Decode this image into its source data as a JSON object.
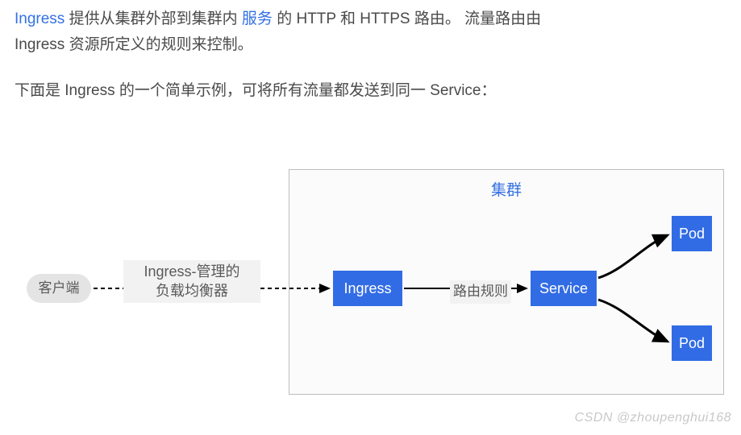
{
  "paragraph1": {
    "ingress_link": "Ingress",
    "t1": " 提供从集群外部到集群内",
    "service_link": "服务",
    "t2": "的 HTTP 和 HTTPS 路由。 流量路由由 Ingress 资源所定义的规则来控制。"
  },
  "paragraph2": "下面是 Ingress 的一个简单示例，可将所有流量都发送到同一 Service：",
  "diagram": {
    "cluster_title": "集群",
    "client": "客户端",
    "load_balancer_line1": "Ingress-管理的",
    "load_balancer_line2": "负载均衡器",
    "ingress_box": "Ingress",
    "routing_rule": "路由规则",
    "service_box": "Service",
    "pod1": "Pod",
    "pod2": "Pod"
  },
  "watermark": "CSDN @zhoupenghui168"
}
